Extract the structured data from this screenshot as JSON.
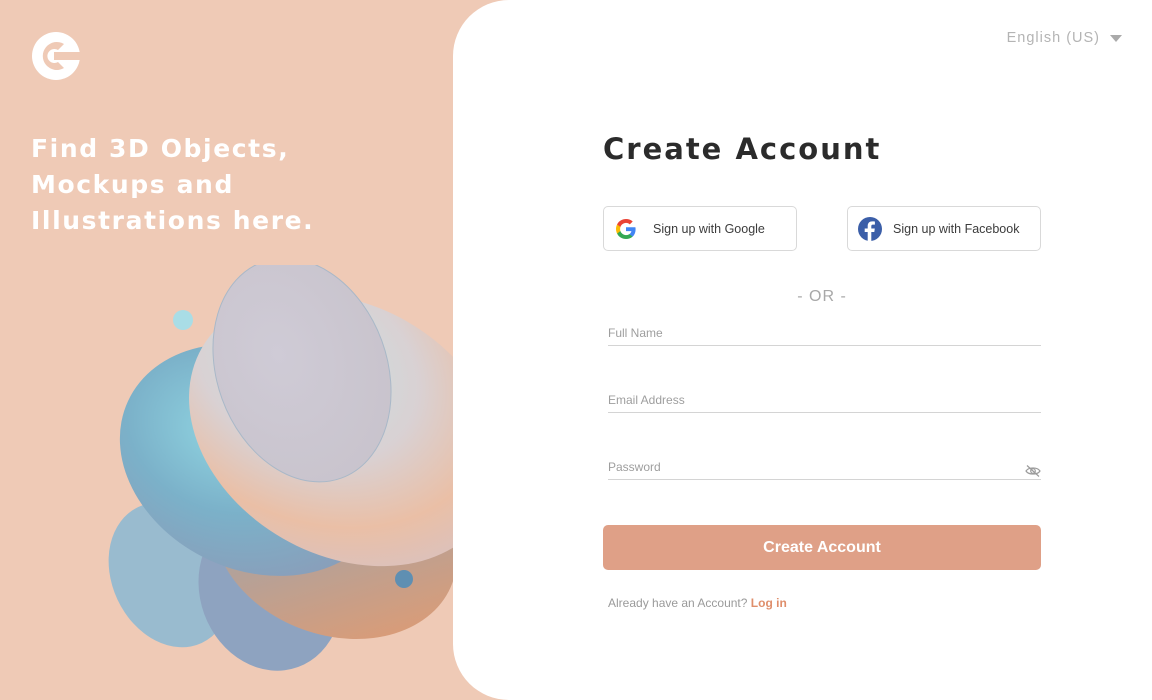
{
  "brand": {
    "logo_icon": "c-logo-icon",
    "tagline": "Find 3D Objects, Mockups and Illustrations here."
  },
  "language": {
    "selected": "English (US)",
    "icon": "caret-down-icon"
  },
  "form": {
    "title": "Create Account",
    "google_label": "Sign up with Google",
    "facebook_label": "Sign up with Facebook",
    "separator": "- OR -",
    "full_name_placeholder": "Full Name",
    "email_placeholder": "Email Address",
    "password_placeholder": "Password",
    "submit_label": "Create Account",
    "login_prompt": "Already have an Account?",
    "login_link": "Log in"
  },
  "colors": {
    "left_background": "#efcab6",
    "accent_button": "#dfa087",
    "login_link": "#df8e6b",
    "title_text": "#2b2b2b"
  }
}
